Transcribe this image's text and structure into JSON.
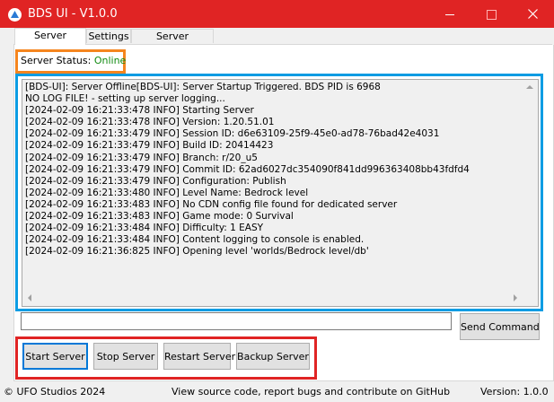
{
  "window": {
    "title": "BDS UI - V1.0.0"
  },
  "tabs": [
    {
      "label": "Server Control",
      "active": true
    },
    {
      "label": "Settings",
      "active": false
    },
    {
      "label": "Server Properties",
      "active": false
    }
  ],
  "status": {
    "label": "Server Status:",
    "value": "Online",
    "value_color": "#108a10"
  },
  "log": [
    "[BDS-UI]: Server Offline[BDS-UI]: Server Startup Triggered. BDS PID is 6968",
    "NO LOG FILE! - setting up server logging...",
    "[2024-02-09 16:21:33:478 INFO] Starting Server",
    "[2024-02-09 16:21:33:478 INFO] Version: 1.20.51.01",
    "[2024-02-09 16:21:33:479 INFO] Session ID: d6e63109-25f9-45e0-ad78-76bad42e4031",
    "[2024-02-09 16:21:33:479 INFO] Build ID: 20414423",
    "[2024-02-09 16:21:33:479 INFO] Branch: r/20_u5",
    "[2024-02-09 16:21:33:479 INFO] Commit ID: 62ad6027dc354090f841dd996363408bb43fdfd4",
    "[2024-02-09 16:21:33:479 INFO] Configuration: Publish",
    "[2024-02-09 16:21:33:480 INFO] Level Name: Bedrock level",
    "[2024-02-09 16:21:33:483 INFO] No CDN config file found for dedicated server",
    "[2024-02-09 16:21:33:483 INFO] Game mode: 0 Survival",
    "[2024-02-09 16:21:33:484 INFO] Difficulty: 1 EASY",
    "[2024-02-09 16:21:33:484 INFO] Content logging to console is enabled.",
    "[2024-02-09 16:21:36:825 INFO] Opening level 'worlds/Bedrock level/db'"
  ],
  "command": {
    "value": "",
    "send_label": "Send Command"
  },
  "controls": {
    "start": "Start Server",
    "stop": "Stop Server",
    "restart": "Restart Server",
    "backup": "Backup Server"
  },
  "footer": {
    "left": "© UFO Studios 2024",
    "center": "View source code, report bugs and contribute on GitHub",
    "right": "Version: 1.0.0"
  },
  "colors": {
    "titlebar": "#e02424",
    "highlight_orange": "#f5851e",
    "highlight_blue": "#0c9ce3",
    "highlight_red": "#e02424"
  }
}
